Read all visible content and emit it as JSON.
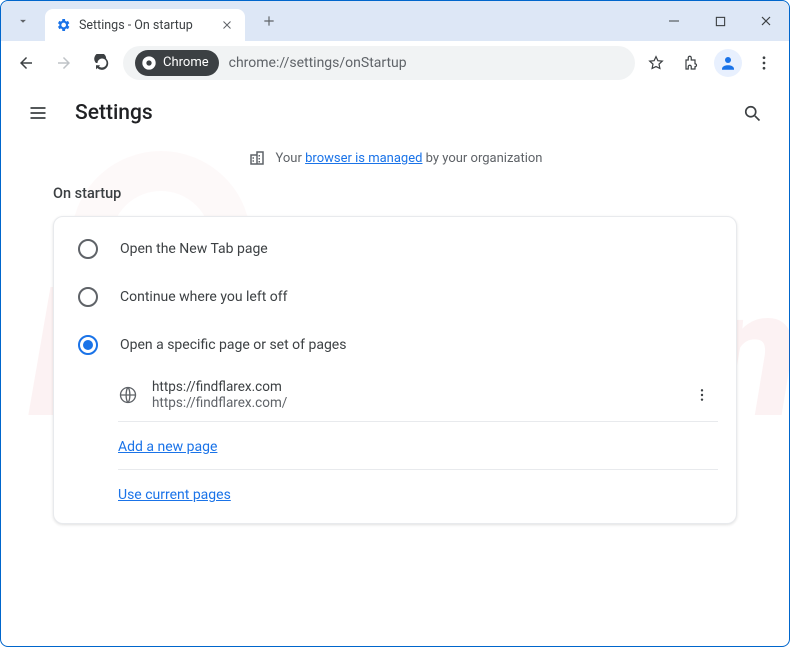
{
  "window": {
    "tab_title": "Settings - On startup"
  },
  "toolbar": {
    "chrome_chip": "Chrome",
    "url": "chrome://settings/onStartup"
  },
  "settings": {
    "title": "Settings",
    "managed_prefix": "Your ",
    "managed_link": "browser is managed",
    "managed_suffix": " by your organization",
    "section_label": "On startup",
    "options": {
      "newtab": "Open the New Tab page",
      "continue": "Continue where you left off",
      "specific": "Open a specific page or set of pages"
    },
    "startup_page": {
      "title": "https://findflarex.com",
      "url": "https://findflarex.com/"
    },
    "add_page": "Add a new page",
    "use_current": "Use current pages"
  }
}
